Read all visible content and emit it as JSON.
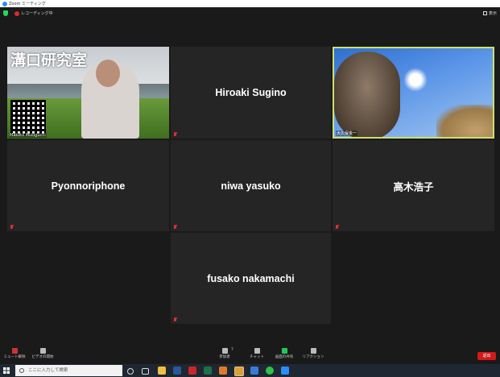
{
  "window": {
    "title": "Zoom ミーティング"
  },
  "header": {
    "recording_label": "レコーディング中",
    "view_label": "表示"
  },
  "participants": [
    {
      "name": "",
      "tile_label": "Makoto Mizoguchi",
      "overlay_text": "溝口研究室",
      "muted": true
    },
    {
      "name": "Hiroaki Sugino",
      "muted": true
    },
    {
      "name": "",
      "tile_label": "大久保金一",
      "muted": false,
      "active_speaker": true
    },
    {
      "name": "Pyonnoriphone",
      "muted": true
    },
    {
      "name": "niwa yasuko",
      "muted": true
    },
    {
      "name": "高木浩子",
      "muted": true
    },
    {
      "name": "fusako nakamachi",
      "muted": true
    }
  ],
  "toolbar": {
    "mute_label": "ミュート解除",
    "video_label": "ビデオの開始",
    "participants_label": "参加者",
    "participants_count": "7",
    "chat_label": "チャット",
    "share_label": "画面の共有",
    "reactions_label": "リアクション",
    "end_label": "退出"
  },
  "taskbar": {
    "search_placeholder": "ここに入力して検索"
  },
  "colors": {
    "active_border": "#cde06e",
    "end_button": "#d11a1a",
    "share_icon": "#23c55e"
  }
}
